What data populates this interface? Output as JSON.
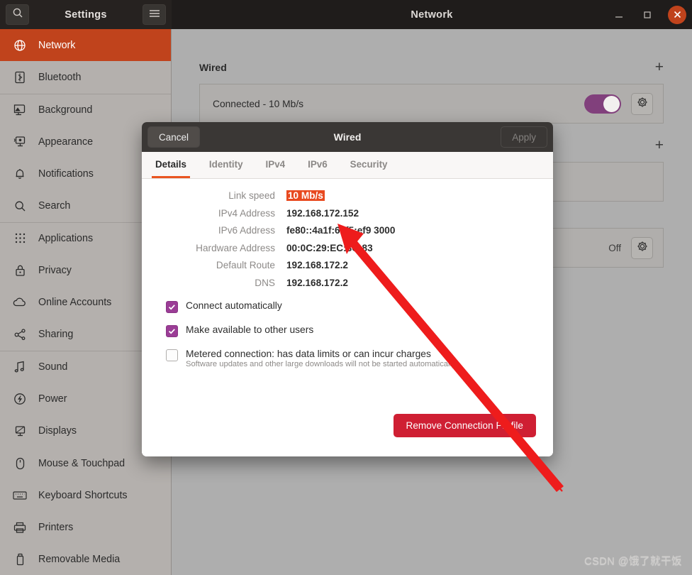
{
  "window": {
    "app_title": "Settings",
    "page_title": "Network",
    "search_icon": "search-icon",
    "menu_icon": "hamburger-menu-icon",
    "minimize_label": "—",
    "maximize_label": "□",
    "close_label": "✕",
    "close_color": "#c0431c"
  },
  "sidebar": {
    "selected": "Network",
    "accent": "#c0431c",
    "items": [
      {
        "label": "Network",
        "icon": "globe-icon",
        "selected": true,
        "separator": false
      },
      {
        "label": "Bluetooth",
        "icon": "bluetooth-icon",
        "selected": false,
        "separator": false
      },
      {
        "label": "Background",
        "icon": "background-icon",
        "selected": false,
        "separator": true
      },
      {
        "label": "Appearance",
        "icon": "appearance-icon",
        "selected": false,
        "separator": false
      },
      {
        "label": "Notifications",
        "icon": "bell-icon",
        "selected": false,
        "separator": false
      },
      {
        "label": "Search",
        "icon": "search-icon",
        "selected": false,
        "separator": false
      },
      {
        "label": "Applications",
        "icon": "grid-apps-icon",
        "selected": false,
        "separator": true
      },
      {
        "label": "Privacy",
        "icon": "lock-icon",
        "selected": false,
        "separator": false
      },
      {
        "label": "Online Accounts",
        "icon": "cloud-icon",
        "selected": false,
        "separator": false
      },
      {
        "label": "Sharing",
        "icon": "share-icon",
        "selected": false,
        "separator": false
      },
      {
        "label": "Sound",
        "icon": "music-note-icon",
        "selected": false,
        "separator": true
      },
      {
        "label": "Power",
        "icon": "power-icon",
        "selected": false,
        "separator": false
      },
      {
        "label": "Displays",
        "icon": "display-icon",
        "selected": false,
        "separator": false
      },
      {
        "label": "Mouse & Touchpad",
        "icon": "mouse-icon",
        "selected": false,
        "separator": false
      },
      {
        "label": "Keyboard Shortcuts",
        "icon": "keyboard-icon",
        "selected": false,
        "separator": false
      },
      {
        "label": "Printers",
        "icon": "printer-icon",
        "selected": false,
        "separator": false
      },
      {
        "label": "Removable Media",
        "icon": "removable-media-icon",
        "selected": false,
        "separator": false
      }
    ]
  },
  "network_panel": {
    "sections": [
      {
        "title": "Wired",
        "add_icon": "plus-icon",
        "row_label": "Connected - 10 Mb/s",
        "toggle_on": true,
        "toggle_color": "#81407c",
        "gear_icon": "gear-icon",
        "status": ""
      },
      {
        "title": "",
        "add_icon": "plus-icon",
        "row_label": "",
        "toggle_on": false,
        "toggle_color": "",
        "gear_icon": "",
        "status": ""
      },
      {
        "title": "",
        "add_icon": "",
        "row_label": "",
        "toggle_on": false,
        "toggle_color": "",
        "gear_icon": "gear-icon",
        "status": "Off"
      }
    ]
  },
  "dialog": {
    "title": "Wired",
    "cancel_label": "Cancel",
    "apply_label": "Apply",
    "tabs": [
      {
        "label": "Details",
        "active": true
      },
      {
        "label": "Identity",
        "active": false
      },
      {
        "label": "IPv4",
        "active": false
      },
      {
        "label": "IPv6",
        "active": false
      },
      {
        "label": "Security",
        "active": false
      }
    ],
    "active_tab_accent": "#e95420",
    "details": [
      {
        "label": "Link speed",
        "value": "10 Mb/s",
        "highlight": true
      },
      {
        "label": "IPv4 Address",
        "value": "192.168.172.152",
        "highlight": false
      },
      {
        "label": "IPv6 Address",
        "value": "fe80::4a1f:68f5:ef9  3000",
        "highlight": false
      },
      {
        "label": "Hardware Address",
        "value": "00:0C:29:EC:8C:83",
        "highlight": false
      },
      {
        "label": "Default Route",
        "value": "192.168.172.2",
        "highlight": false
      },
      {
        "label": "DNS",
        "value": "192.168.172.2",
        "highlight": false
      }
    ],
    "highlight_color": "#e8491f",
    "checkbox_color": "#9b3d96",
    "checkboxes": [
      {
        "label": "Connect automatically",
        "checked": true,
        "sub": ""
      },
      {
        "label": "Make available to other users",
        "checked": true,
        "sub": ""
      },
      {
        "label": "Metered connection: has data limits or can incur charges",
        "checked": false,
        "sub": "Software updates and other large downloads will not be started automatically."
      }
    ],
    "remove_label": "Remove Connection Profile",
    "remove_color": "#cf1f33"
  },
  "annotation": {
    "arrow_color": "#ee1c1c",
    "arrow_name": "red-pointer-arrow"
  },
  "watermark": {
    "text": "CSDN @饿了就干饭"
  }
}
